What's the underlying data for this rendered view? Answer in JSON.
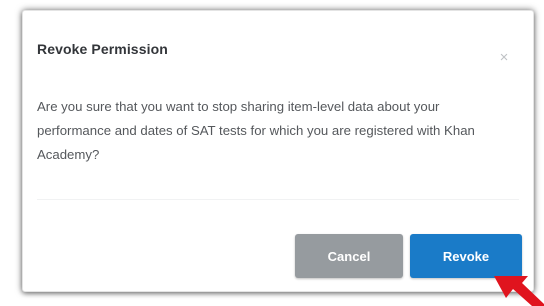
{
  "dialog": {
    "title": "Revoke Permission",
    "close_glyph": "×",
    "message": "Are you sure that you want to stop sharing item-level data about your performance and dates of SAT tests for which you are registered with Khan Academy?",
    "buttons": {
      "cancel_label": "Cancel",
      "revoke_label": "Revoke"
    }
  },
  "colors": {
    "cancel_button": "#969b9f",
    "revoke_button": "#1a7bc8",
    "annotation_arrow": "#e0141e"
  },
  "icons": {
    "close": "close-icon",
    "annotation": "red-arrow-icon"
  }
}
